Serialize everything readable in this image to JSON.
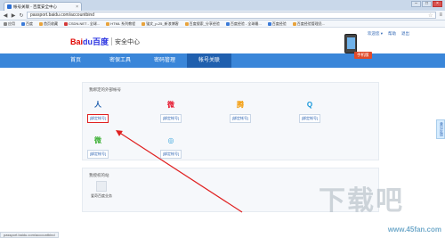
{
  "browser": {
    "tab_title": "帐号关联 - 百度安全中心",
    "tab_close": "×",
    "minimize": "–",
    "maximize": "□",
    "close": "×",
    "back": "◀",
    "forward": "▶",
    "reload": "↻",
    "url": "passport.baidu.com/accountbind",
    "star": "☆",
    "menu": "≡",
    "bookmarks": [
      {
        "label": "应用",
        "icon": "apps-icon"
      },
      {
        "label": "百度",
        "icon": "baidu-icon"
      },
      {
        "label": "首页收藏",
        "icon": "bookmark-icon"
      },
      {
        "label": "CSDN.NET - 全球...",
        "icon": "csdn-icon"
      },
      {
        "label": "HTML 系列教程",
        "icon": "bookmark-icon"
      },
      {
        "label": "锚文_p-25_新浪博客",
        "icon": "bookmark-icon"
      },
      {
        "label": "百度搜索_分享经验",
        "icon": "bookmark-icon"
      },
      {
        "label": "百度经验 - 全球最...",
        "icon": "baidu-icon"
      },
      {
        "label": "百度经验",
        "icon": "baidu-icon"
      },
      {
        "label": "百度经验管理员...",
        "icon": "bookmark-icon"
      }
    ],
    "status_url": "passport.baidu.com/accountbind"
  },
  "header": {
    "logo_red": "Bai",
    "logo_blue": "du百度",
    "subtitle": "安全中心",
    "user": "欢迎您 ▾",
    "help": "帮助",
    "logout": "退出"
  },
  "promo_badge": "手机版",
  "nav": {
    "items": [
      {
        "label": "首页",
        "active": false
      },
      {
        "label": "密保工具",
        "active": false
      },
      {
        "label": "密码管理",
        "active": false
      },
      {
        "label": "帐号关联",
        "active": true
      }
    ]
  },
  "bound_section": {
    "title": "我绑定的外部帐号",
    "accounts": [
      {
        "name": "renren",
        "link": "[绑定帐号]",
        "color": "#1f5fae",
        "glyph": "人"
      },
      {
        "name": "weibo",
        "link": "[绑定帐号]",
        "color": "#e6162d",
        "glyph": "微"
      },
      {
        "name": "tencent-weibo",
        "link": "[绑定帐号]",
        "color": "#f39800",
        "glyph": "腾"
      },
      {
        "name": "qq",
        "link": "[绑定帐号]",
        "color": "#1296db",
        "glyph": "Q"
      },
      {
        "name": "wechat",
        "link": "[绑定帐号]",
        "color": "#3cb034",
        "glyph": "微"
      },
      {
        "name": "tianyi",
        "link": "[绑定帐号]",
        "color": "#33a3dc",
        "glyph": "◎"
      }
    ]
  },
  "app_section": {
    "title": "我授权的站",
    "app_label": "爱奇百度业务"
  },
  "side_widget": "意见反馈",
  "watermark": {
    "big": "下载吧",
    "url": "www.45fan.com"
  }
}
